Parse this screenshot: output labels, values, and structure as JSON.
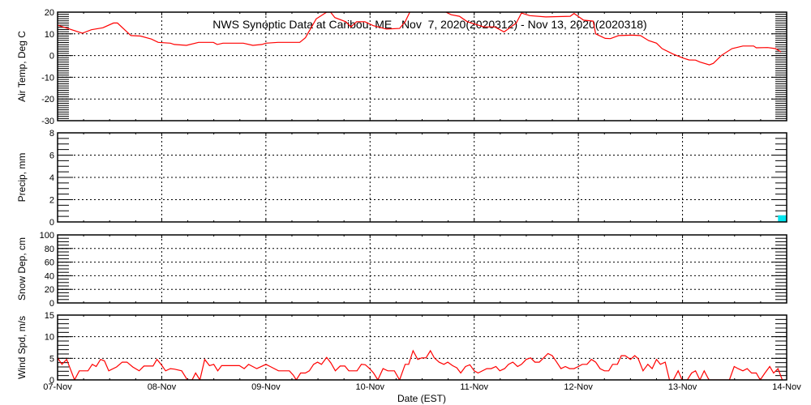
{
  "colors": {
    "line": "#ff0000",
    "precip": "#00e5ee",
    "axis": "#000000",
    "background": "#ffffff"
  },
  "chart_data": [
    {
      "type": "line",
      "title": "NWS Synoptic Data at Caribou, ME   Nov  7, 2020(2020312) - Nov 13, 2020(2020318)",
      "ylabel": "Air Temp, Deg C",
      "xlabel": "Date (EST)",
      "x_units": "hours since 07-Nov 00:00",
      "xlim": [
        0,
        168
      ],
      "ylim": [
        -30,
        20
      ],
      "yticks": [
        -30,
        -20,
        -10,
        0,
        10,
        20
      ],
      "ytick_labels": [
        "-30",
        "-20",
        "-10",
        "0",
        "10",
        "20"
      ],
      "grid": true,
      "series": [
        {
          "name": "Air Temp",
          "points": [
            [
              0,
              14.0
            ],
            [
              2.6,
              12.3
            ],
            [
              5.7,
              10.3
            ],
            [
              7.8,
              11.9
            ],
            [
              10.4,
              12.8
            ],
            [
              12.9,
              15.0
            ],
            [
              13.8,
              15.0
            ],
            [
              16.9,
              9.2
            ],
            [
              19.1,
              9.0
            ],
            [
              21.6,
              7.6
            ],
            [
              23.2,
              6.1
            ],
            [
              26.0,
              5.7
            ],
            [
              26.9,
              5.1
            ],
            [
              29.7,
              4.7
            ],
            [
              32.5,
              6.1
            ],
            [
              35.9,
              6.1
            ],
            [
              36.8,
              5.1
            ],
            [
              38.1,
              5.7
            ],
            [
              42.8,
              5.7
            ],
            [
              45.0,
              4.7
            ],
            [
              47.1,
              5.1
            ],
            [
              48.0,
              5.7
            ],
            [
              50.8,
              6.1
            ],
            [
              53.4,
              6.1
            ],
            [
              55.8,
              6.1
            ],
            [
              57.1,
              8.2
            ],
            [
              59.6,
              16.9
            ],
            [
              62.0,
              20.0
            ],
            [
              62.9,
              20.0
            ],
            [
              63.9,
              17.5
            ],
            [
              66.4,
              15.6
            ],
            [
              67.6,
              13.2
            ],
            [
              68.9,
              15.6
            ],
            [
              70.8,
              15.6
            ],
            [
              72.7,
              13.8
            ],
            [
              75.8,
              12.2
            ],
            [
              78.8,
              12.5
            ],
            [
              80.1,
              15.6
            ],
            [
              81.4,
              21.0
            ],
            [
              82.9,
              22.0
            ],
            [
              85.7,
              22.0
            ],
            [
              89.5,
              20.0
            ],
            [
              90.7,
              18.8
            ],
            [
              92.6,
              18.1
            ],
            [
              94.4,
              15.6
            ],
            [
              98.2,
              13.2
            ],
            [
              100.7,
              13.2
            ],
            [
              102.9,
              10.9
            ],
            [
              105.7,
              15.0
            ],
            [
              106.9,
              19.6
            ],
            [
              108.8,
              18.4
            ],
            [
              112.5,
              17.8
            ],
            [
              118.1,
              18.1
            ],
            [
              119.0,
              19.4
            ],
            [
              121.2,
              16.3
            ],
            [
              123.4,
              15.9
            ],
            [
              124.0,
              10.0
            ],
            [
              126.2,
              7.9
            ],
            [
              127.4,
              7.8
            ],
            [
              129.3,
              9.2
            ],
            [
              132.4,
              9.4
            ],
            [
              134.3,
              9.2
            ],
            [
              136.2,
              6.9
            ],
            [
              138.0,
              5.7
            ],
            [
              139.3,
              3.2
            ],
            [
              141.8,
              0.7
            ],
            [
              144.2,
              -1.2
            ],
            [
              145.5,
              -2.0
            ],
            [
              147.0,
              -2.1
            ],
            [
              148.0,
              -3.0
            ],
            [
              150.2,
              -4.3
            ],
            [
              151.1,
              -3.6
            ],
            [
              153.0,
              0.1
            ],
            [
              155.4,
              3.2
            ],
            [
              157.9,
              4.4
            ],
            [
              160.4,
              4.4
            ],
            [
              161.0,
              3.6
            ],
            [
              163.6,
              3.7
            ],
            [
              165.4,
              3.2
            ],
            [
              166.7,
              1.7
            ]
          ]
        }
      ]
    },
    {
      "type": "bar",
      "ylabel": "Precip, mm",
      "x_units": "hours since 07-Nov 00:00",
      "xlim": [
        0,
        168
      ],
      "ylim": [
        0,
        8
      ],
      "yticks": [
        0,
        2,
        4,
        6,
        8
      ],
      "ytick_labels": [
        "0",
        "2",
        "4",
        "6",
        "8"
      ],
      "grid": true,
      "series": [
        {
          "name": "Precip",
          "bars": [
            [
              166,
              168,
              0.6
            ]
          ]
        }
      ]
    },
    {
      "type": "line",
      "ylabel": "Snow Dep, cm",
      "xlim": [
        0,
        168
      ],
      "ylim": [
        0,
        100
      ],
      "yticks": [
        0,
        20,
        40,
        60,
        80,
        100
      ],
      "ytick_labels": [
        "0",
        "20",
        "40",
        "60",
        "80",
        "100"
      ],
      "grid": true,
      "series": []
    },
    {
      "type": "line",
      "ylabel": "Wind Spd, m/s",
      "xlabel": "Date (EST)",
      "x_units": "hours since 07-Nov 00:00",
      "xlim": [
        0,
        168
      ],
      "ylim": [
        0,
        15
      ],
      "yticks": [
        0,
        5,
        10,
        15
      ],
      "ytick_labels": [
        "0",
        "5",
        "10",
        "15"
      ],
      "xtick_labels": [
        "07-Nov",
        "08-Nov",
        "09-Nov",
        "10-Nov",
        "11-Nov",
        "12-Nov",
        "13-Nov",
        "14-Nov"
      ],
      "grid": true,
      "series": [
        {
          "name": "Wind Speed",
          "points": [
            [
              0,
              5.1
            ],
            [
              1.0,
              3.6
            ],
            [
              2.1,
              4.75
            ],
            [
              3.9,
              0
            ],
            [
              5.0,
              2.1
            ],
            [
              7.0,
              2.1
            ],
            [
              8.0,
              3.6
            ],
            [
              8.9,
              3.1
            ],
            [
              9.9,
              4.75
            ],
            [
              10.8,
              4.4
            ],
            [
              11.8,
              2.1
            ],
            [
              13.6,
              3.0
            ],
            [
              14.9,
              4.1
            ],
            [
              16.0,
              4.1
            ],
            [
              17.3,
              3.0
            ],
            [
              18.8,
              2.1
            ],
            [
              19.9,
              3.2
            ],
            [
              22.0,
              3.2
            ],
            [
              22.9,
              4.75
            ],
            [
              23.9,
              3.5
            ],
            [
              24.9,
              2.1
            ],
            [
              26.0,
              2.6
            ],
            [
              26.9,
              2.5
            ],
            [
              28.6,
              2.1
            ],
            [
              29.9,
              0
            ],
            [
              31.0,
              0
            ],
            [
              31.8,
              1.6
            ],
            [
              32.8,
              0
            ],
            [
              33.9,
              4.75
            ],
            [
              35.0,
              3.3
            ],
            [
              36.0,
              3.6
            ],
            [
              36.9,
              2.1
            ],
            [
              37.8,
              3.3
            ],
            [
              41.9,
              3.3
            ],
            [
              43.0,
              2.6
            ],
            [
              44.0,
              3.6
            ],
            [
              45.9,
              2.6
            ],
            [
              48.0,
              3.6
            ],
            [
              49.0,
              3.1
            ],
            [
              50.9,
              2.1
            ],
            [
              53.4,
              2.1
            ],
            [
              54.3,
              1.1
            ],
            [
              55.0,
              0
            ],
            [
              56.0,
              1.6
            ],
            [
              57.1,
              1.6
            ],
            [
              58.0,
              2.1
            ],
            [
              59.0,
              3.6
            ],
            [
              59.9,
              4.1
            ],
            [
              60.8,
              3.6
            ],
            [
              62.0,
              5.2
            ],
            [
              63.0,
              3.9
            ],
            [
              64.0,
              2.1
            ],
            [
              65.1,
              3.2
            ],
            [
              66.2,
              3.2
            ],
            [
              67.1,
              2.1
            ],
            [
              69.0,
              2.1
            ],
            [
              70.0,
              3.6
            ],
            [
              70.9,
              3.5
            ],
            [
              71.9,
              2.6
            ],
            [
              72.8,
              1.6
            ],
            [
              73.8,
              0
            ],
            [
              75.0,
              2.6
            ],
            [
              76.1,
              2.1
            ],
            [
              77.6,
              2.1
            ],
            [
              78.8,
              0
            ],
            [
              80.1,
              3.6
            ],
            [
              80.9,
              3.6
            ],
            [
              81.9,
              6.75
            ],
            [
              83.0,
              4.75
            ],
            [
              83.9,
              5.1
            ],
            [
              84.9,
              5.1
            ],
            [
              85.9,
              6.75
            ],
            [
              86.8,
              5.1
            ],
            [
              87.9,
              4.1
            ],
            [
              89.0,
              3.6
            ],
            [
              89.9,
              4.1
            ],
            [
              91.0,
              3.3
            ],
            [
              92.0,
              2.8
            ],
            [
              92.9,
              1.6
            ],
            [
              94.0,
              3.1
            ],
            [
              95.0,
              3.5
            ],
            [
              96.0,
              2.1
            ],
            [
              96.9,
              1.6
            ],
            [
              98.9,
              2.6
            ],
            [
              99.9,
              2.6
            ],
            [
              101.0,
              3.1
            ],
            [
              101.9,
              2.1
            ],
            [
              103.0,
              2.6
            ],
            [
              103.9,
              3.6
            ],
            [
              104.9,
              4.1
            ],
            [
              106.0,
              3.1
            ],
            [
              106.9,
              3.6
            ],
            [
              108.0,
              4.75
            ],
            [
              109.0,
              5.1
            ],
            [
              110.0,
              4.1
            ],
            [
              111.0,
              4.1
            ],
            [
              112.0,
              5.1
            ],
            [
              113.0,
              6.1
            ],
            [
              114.0,
              5.6
            ],
            [
              114.9,
              4.25
            ],
            [
              116.0,
              2.6
            ],
            [
              117.0,
              3.1
            ],
            [
              118.0,
              2.6
            ],
            [
              119.0,
              2.6
            ],
            [
              120.0,
              3.1
            ],
            [
              120.9,
              3.6
            ],
            [
              122.0,
              3.6
            ],
            [
              123.0,
              4.75
            ],
            [
              124.0,
              4.1
            ],
            [
              125.0,
              2.6
            ],
            [
              126.0,
              2.1
            ],
            [
              127.0,
              2.1
            ],
            [
              127.9,
              3.6
            ],
            [
              129.0,
              3.6
            ],
            [
              129.9,
              5.6
            ],
            [
              130.8,
              5.6
            ],
            [
              132.0,
              4.75
            ],
            [
              133.0,
              5.6
            ],
            [
              133.8,
              4.9
            ],
            [
              134.9,
              2.1
            ],
            [
              136.0,
              3.6
            ],
            [
              137.0,
              2.6
            ],
            [
              138.0,
              4.75
            ],
            [
              138.9,
              3.6
            ],
            [
              140.0,
              4.1
            ],
            [
              141.0,
              0
            ],
            [
              141.9,
              0
            ],
            [
              143.0,
              2.1
            ],
            [
              143.9,
              0
            ],
            [
              145.1,
              0
            ],
            [
              146.1,
              1.6
            ],
            [
              147.0,
              2.1
            ],
            [
              148.0,
              0
            ],
            [
              149.0,
              2.1
            ],
            [
              150.1,
              0
            ],
            [
              154.8,
              0
            ],
            [
              155.9,
              3.1
            ],
            [
              156.8,
              2.6
            ],
            [
              157.9,
              2.1
            ],
            [
              158.9,
              2.6
            ],
            [
              159.9,
              1.6
            ],
            [
              161.0,
              1.6
            ],
            [
              161.9,
              0
            ],
            [
              163.0,
              1.6
            ],
            [
              164.1,
              3.1
            ],
            [
              165.0,
              1.6
            ],
            [
              166.0,
              2.6
            ],
            [
              167.0,
              0
            ]
          ]
        }
      ]
    }
  ]
}
